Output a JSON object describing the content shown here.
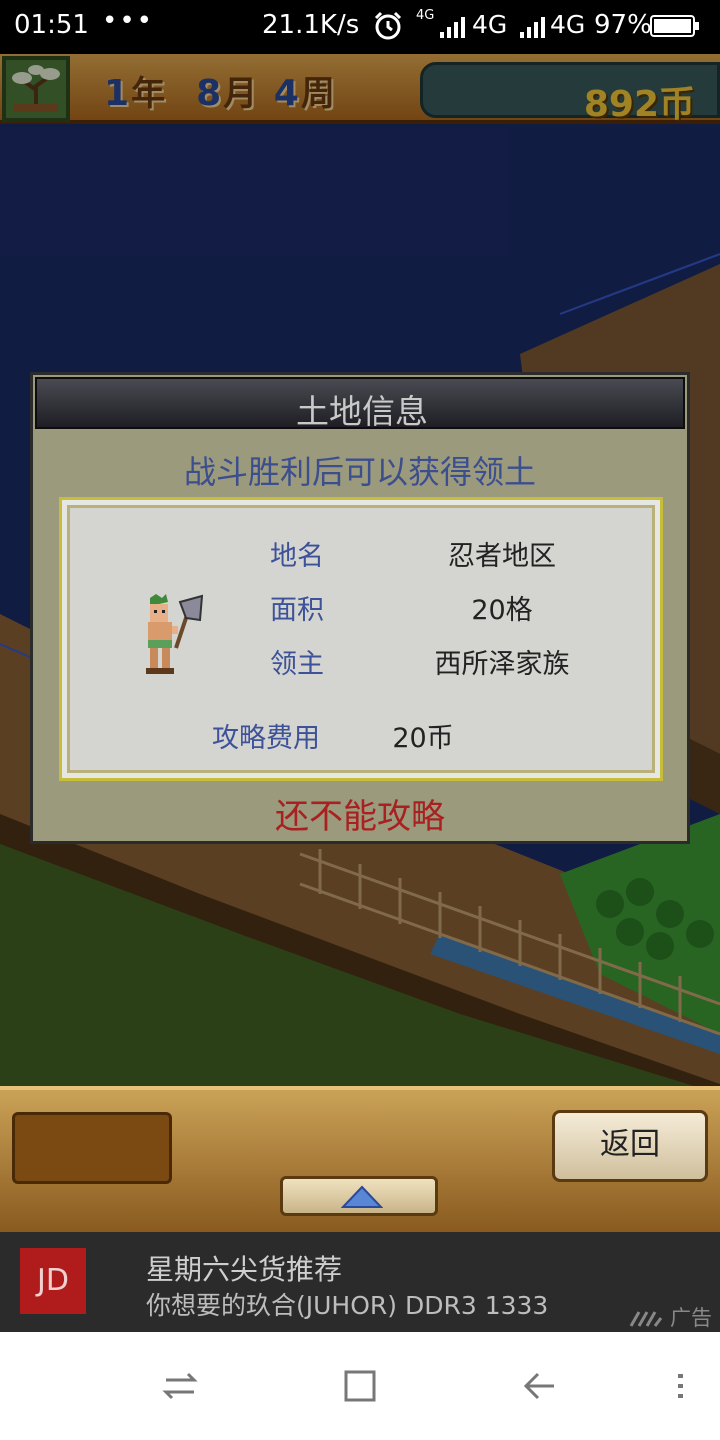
{
  "status_bar": {
    "time": "01:51",
    "dots": "•••",
    "net_speed": "21.1K/s",
    "net1_small": "4G",
    "net1_label": "4G",
    "net2_label": "4G",
    "battery": "97%",
    "icons": [
      "alarm-icon",
      "signal-icon",
      "battery-icon"
    ]
  },
  "hud": {
    "year_num": "1",
    "year_unit": "年",
    "month_num": "8",
    "month_unit": "月",
    "week_num": "4",
    "week_unit": "周",
    "money": "892币",
    "icon": "bonsai-tree-icon"
  },
  "dialog": {
    "title": "土地信息",
    "subtitle": "战斗胜利后可以获得领土",
    "rows": [
      {
        "label": "地名",
        "value": "忍者地区"
      },
      {
        "label": "面积",
        "value": "20格"
      },
      {
        "label": "领主",
        "value": "西所泽家族"
      }
    ],
    "cost_label": "攻略费用",
    "cost_value": "20币",
    "warning": "还不能攻略",
    "portrait": "axe-warrior-icon"
  },
  "bottom_bar": {
    "back_label": "返回",
    "up_icon": "up-arrow-icon"
  },
  "ad": {
    "logo": "JD",
    "title": "星期六尖货推荐",
    "desc": "你想要的玖合(JUHOR) DDR3 1333",
    "tag": "广告"
  },
  "nav": {
    "icons": [
      "switch-icon",
      "home-square-icon",
      "back-icon",
      "menu-icon"
    ]
  },
  "colors": {
    "ocean": "#1b2b68",
    "dialog_label": "#3d5298",
    "warning": "#a82020",
    "money": "#f6c93a"
  }
}
